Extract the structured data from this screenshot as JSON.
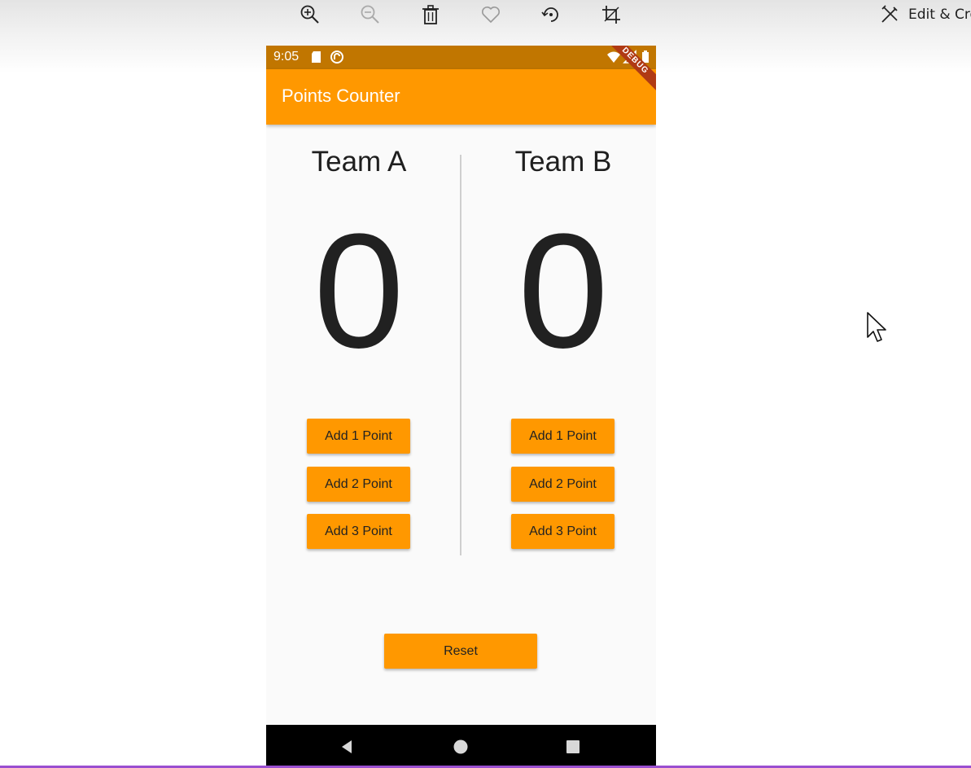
{
  "viewer": {
    "edit_create_label": "Edit & Cre",
    "toolbar_icons": [
      "zoom-in-icon",
      "zoom-out-icon",
      "delete-icon",
      "favorite-icon",
      "rotate-icon",
      "crop-icon"
    ]
  },
  "phone": {
    "status_time": "9:05",
    "status_icons_left": [
      "sd-card-icon",
      "sync-icon"
    ],
    "status_icons_right": [
      "wifi-icon",
      "signal-icon",
      "battery-icon"
    ],
    "app_title": "Points Counter",
    "debug_banner": "DEBUG",
    "colors": {
      "primary": "#ff9800",
      "status_bar": "#c17600",
      "background": "#fafafa"
    }
  },
  "teams": [
    {
      "name": "Team A",
      "score": "0",
      "buttons": [
        "Add 1 Point",
        "Add 2 Point",
        "Add 3 Point"
      ]
    },
    {
      "name": "Team B",
      "score": "0",
      "buttons": [
        "Add 1 Point",
        "Add 2 Point",
        "Add 3 Point"
      ]
    }
  ],
  "reset_label": "Reset",
  "nav": [
    "back-icon",
    "home-icon",
    "recents-icon"
  ]
}
